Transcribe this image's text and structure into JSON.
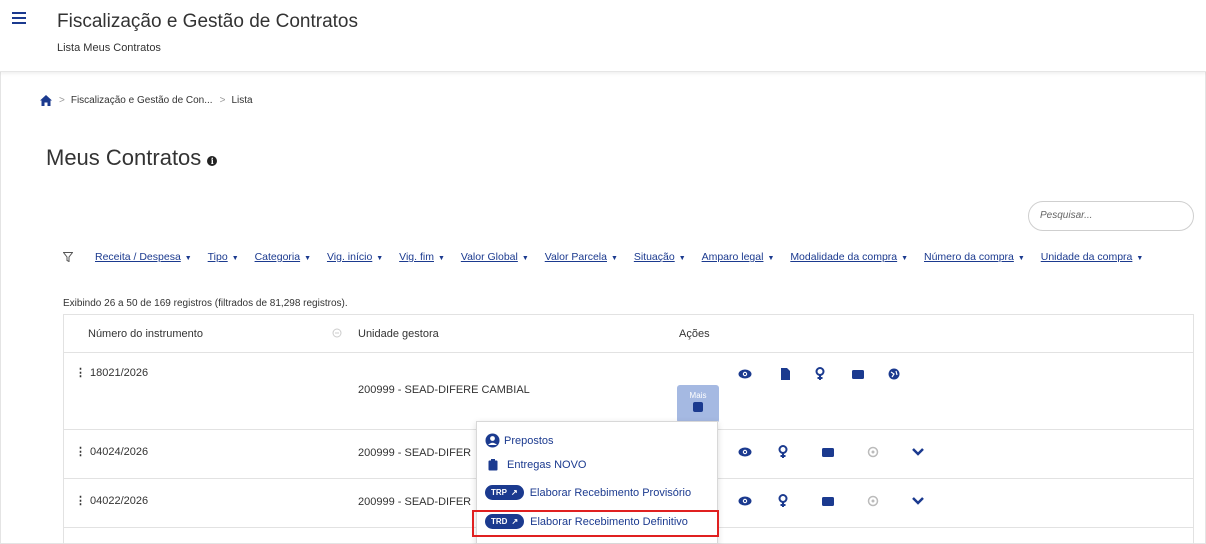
{
  "header": {
    "title": "Fiscalização e Gestão de Contratos",
    "subtitle": "Lista Meus Contratos"
  },
  "breadcrumb": {
    "items": [
      "Fiscalização e Gestão de Con...",
      "Lista"
    ]
  },
  "page": {
    "title": "Meus Contratos"
  },
  "search": {
    "placeholder": "Pesquisar..."
  },
  "filters": [
    "Receita / Despesa",
    "Tipo",
    "Categoria",
    "Vig. início",
    "Vig. fim",
    "Valor Global",
    "Valor Parcela",
    "Situação",
    "Amparo legal",
    "Modalidade da compra",
    "Número da compra",
    "Unidade da compra"
  ],
  "records_info": "Exibindo 26 a 50 de 169 registros (filtrados de 81,298 registros).",
  "table": {
    "headers": [
      "Número do instrumento",
      "Unidade gestora",
      "Ações"
    ],
    "rows": [
      {
        "numero": "18021/2026",
        "unidade": "200999 - SEAD-DIFERE CAMBIAL"
      },
      {
        "numero": "04024/2026",
        "unidade": "200999 - SEAD-DIFER"
      },
      {
        "numero": "04022/2026",
        "unidade": "200999 - SEAD-DIFER"
      }
    ],
    "mais_label": "Mais"
  },
  "dropdown": {
    "items": [
      {
        "label": "Prepostos",
        "icon": "user-circle-icon"
      },
      {
        "label": "Entregas NOVO",
        "icon": "clipboard-icon"
      },
      {
        "label": "Elaborar Recebimento Provisório",
        "badge": "TRP"
      },
      {
        "label": "Elaborar Recebimento Definitivo",
        "badge": "TRD"
      }
    ]
  },
  "colors": {
    "primary": "#1b3a8f",
    "highlight": "#e02020",
    "tooltip": "#a5b9e2"
  }
}
